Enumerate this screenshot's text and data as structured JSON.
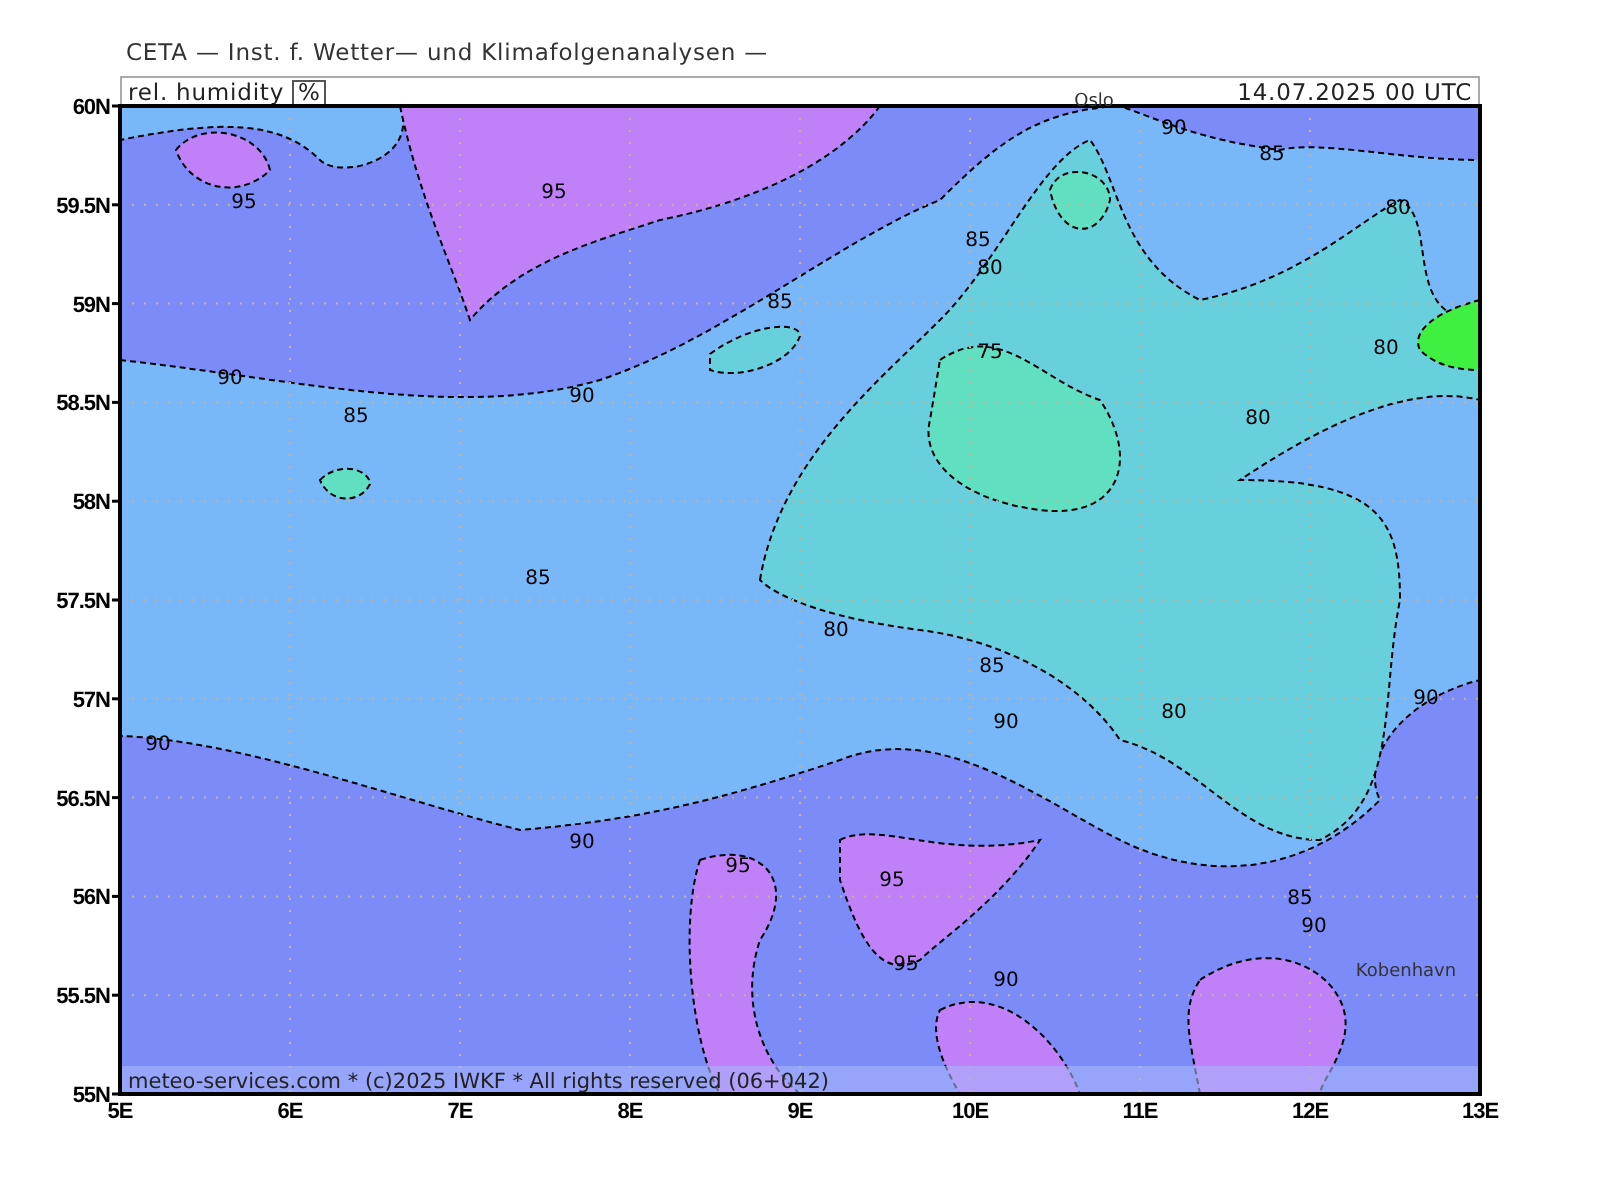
{
  "header": {
    "institute": "CETA — Inst. f. Wetter— und Klimafolgenanalysen —"
  },
  "title_bar": {
    "parameter": "rel. humidity",
    "unit": "%",
    "valid_time": "14.07.2025 00 UTC"
  },
  "map": {
    "lat_labels": [
      "60N",
      "59.5N",
      "59N",
      "58.5N",
      "58N",
      "57.5N",
      "57N",
      "56.5N",
      "56N",
      "55.5N",
      "55N"
    ],
    "lon_labels": [
      "5E",
      "6E",
      "7E",
      "8E",
      "9E",
      "10E",
      "11E",
      "12E",
      "13E"
    ],
    "contour_labels": [
      {
        "text": "95"
      },
      {
        "text": "95"
      },
      {
        "text": "90"
      },
      {
        "text": "85"
      },
      {
        "text": "90"
      },
      {
        "text": "85"
      },
      {
        "text": "85"
      },
      {
        "text": "80"
      },
      {
        "text": "85"
      },
      {
        "text": "90"
      },
      {
        "text": "80"
      },
      {
        "text": "90"
      },
      {
        "text": "90"
      },
      {
        "text": "95"
      },
      {
        "text": "95"
      },
      {
        "text": "95"
      },
      {
        "text": "90"
      },
      {
        "text": "85"
      },
      {
        "text": "90"
      },
      {
        "text": "90"
      },
      {
        "text": "90"
      },
      {
        "text": "85"
      },
      {
        "text": "80"
      },
      {
        "text": "85"
      },
      {
        "text": "80"
      },
      {
        "text": "75"
      },
      {
        "text": "80"
      },
      {
        "text": "80"
      }
    ],
    "cities": [
      {
        "name": "Oslo"
      },
      {
        "name": "Kobenhavn"
      }
    ],
    "footer": "meteo-services.com * (c)2025 IWKF * All rights reserved (06+042)"
  }
}
